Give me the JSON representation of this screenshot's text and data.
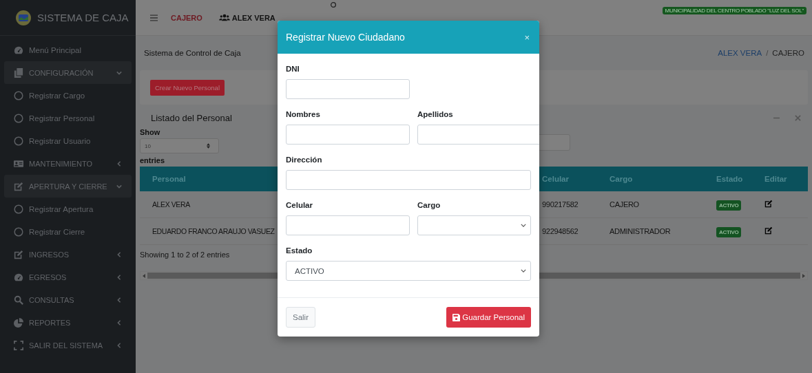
{
  "sidebar": {
    "brand": "SISTEMA DE CAJA",
    "items": [
      {
        "kind": "link",
        "label": "Menú Principal"
      },
      {
        "kind": "group",
        "label": "CONFIGURACIÓN",
        "expanded": true,
        "children": [
          {
            "label": "Registrar Cargo"
          },
          {
            "label": "Registrar Personal"
          },
          {
            "label": "Registrar Usuario"
          }
        ]
      },
      {
        "kind": "group",
        "label": "MANTENIMIENTO",
        "expanded": false
      },
      {
        "kind": "group",
        "label": "APERTURA Y CIERRE",
        "expanded": true,
        "children": [
          {
            "label": "Registrar Apertura"
          },
          {
            "label": "Registrar Cierre"
          }
        ]
      },
      {
        "kind": "group",
        "label": "INGRESOS",
        "expanded": false
      },
      {
        "kind": "group",
        "label": "EGRESOS",
        "expanded": false
      },
      {
        "kind": "group",
        "label": "CONSULTAS",
        "expanded": false
      },
      {
        "kind": "group",
        "label": "REPORTES",
        "expanded": false
      },
      {
        "kind": "group",
        "label": "SALIR DEL SISTEMA",
        "expanded": false
      }
    ]
  },
  "topbar": {
    "role": "CAJERO",
    "user": "ALEX VERA",
    "badge": "MUNICIPALIDAD DEL CENTRO POBLADO \"LUZ DEL SOL\""
  },
  "breadcrumb": {
    "title": "Sistema de Control de Caja",
    "user": "ALEX VERA",
    "separator": "/",
    "role": "CAJERO"
  },
  "card": {
    "button": "Crear Nuevo Personal",
    "list_title": "Listado del Personal",
    "show_label": "Show",
    "page_size": "10",
    "entries_label": "entries",
    "table": {
      "columns": [
        "Personal",
        "Celular",
        "Cargo",
        "Estado",
        "Editar"
      ],
      "rows": [
        {
          "personal": "ALEX VERA",
          "celular": "990217582",
          "cargo": "CAJERO",
          "estado": "ACTIVO"
        },
        {
          "personal": "EDUARDO FRANCO ARAUJO VASUEZ",
          "celular": "922948562",
          "cargo": "ADMINISTRADOR",
          "estado": "ACTIVO"
        }
      ]
    },
    "info": "Showing 1 to 2 of 2 entries"
  },
  "modal": {
    "title": "Registrar Nuevo Ciudadano",
    "close": "×",
    "rows": [
      [
        {
          "label": "DNI",
          "kind": "text",
          "wide": false
        }
      ],
      [
        {
          "label": "Nombres",
          "kind": "text",
          "wide": false
        },
        {
          "label": "Apellidos",
          "kind": "text",
          "wide": false
        }
      ],
      [
        {
          "label": "Dirección",
          "kind": "text",
          "wide": true
        }
      ],
      [
        {
          "label": "Celular",
          "kind": "text",
          "wide": false
        },
        {
          "label": "Cargo",
          "kind": "select",
          "wide": false
        }
      ],
      [
        {
          "label": "Estado",
          "kind": "select",
          "wide": true,
          "value": "ACTIVO"
        }
      ]
    ],
    "cancel": "Salir",
    "save": "Guardar Personal"
  }
}
